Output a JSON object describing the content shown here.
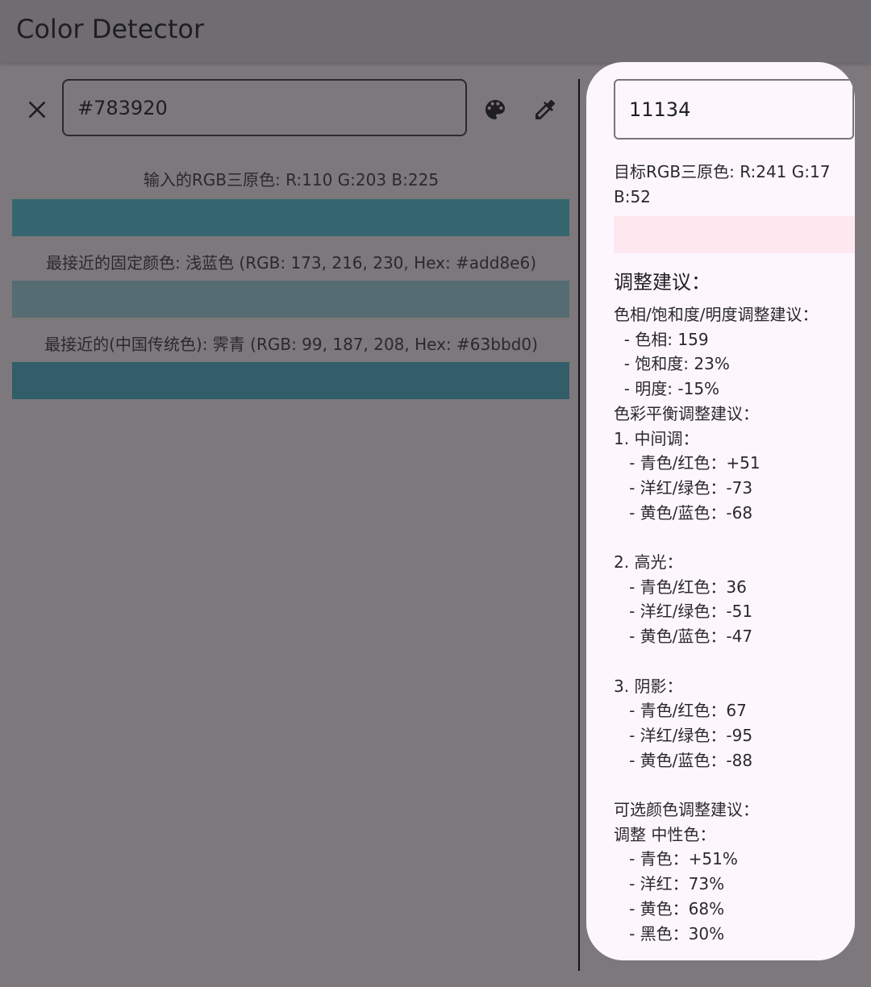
{
  "app": {
    "title": "Color Detector"
  },
  "input": {
    "hex_value": "#783920"
  },
  "icons": {
    "close": "close-icon",
    "palette": "palette-icon",
    "picker": "colorize-icon"
  },
  "results": {
    "input_rgb_label": "输入的RGB三原色: R:110 G:203 B:225",
    "input_color": "#356670",
    "nearest_fixed_label": "最接近的固定颜色: 浅蓝色 (RGB: 173, 216, 230, Hex: #add8e6)",
    "nearest_fixed_color": "#566c73",
    "nearest_traditional_label": "最接近的(中国传统色): 霁青 (RGB: 99, 187, 208, Hex: #63bbd0)",
    "nearest_traditional_color": "#315e68"
  },
  "target": {
    "input_value": "11134",
    "rgb_label": "目标RGB三原色: R:241 G:17 B:52",
    "color": "#fde8f0",
    "advice_heading": "调整建议：",
    "advice_text": "色相/饱和度/明度调整建议：\n  - 色相: 159\n  - 饱和度: 23%\n  - 明度: -15%\n色彩平衡调整建议：\n1. 中间调：\n   - 青色/红色：+51\n   - 洋红/绿色：-73\n   - 黄色/蓝色：-68\n\n2. 高光：\n   - 青色/红色：36\n   - 洋红/绿色：-51\n   - 黄色/蓝色：-47\n\n3. 阴影：\n   - 青色/红色：67\n   - 洋红/绿色：-95\n   - 黄色/蓝色：-88\n\n可选颜色调整建议：\n调整 中性色：\n   - 青色：+51%\n   - 洋红：73%\n   - 黄色：68%\n   - 黑色：30%"
  }
}
